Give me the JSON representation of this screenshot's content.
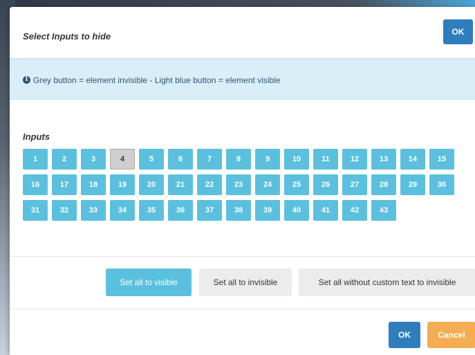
{
  "dialog": {
    "title": "Select Inputs to hide",
    "ok_top_label": "OK"
  },
  "alert": {
    "icon": "info-circle-icon",
    "icon_glyph": "i",
    "text": "Grey button = element invisible - Light blue button = element visible"
  },
  "inputs": {
    "label": "Inputs",
    "items": [
      {
        "label": "1",
        "visible": true
      },
      {
        "label": "2",
        "visible": true
      },
      {
        "label": "3",
        "visible": true
      },
      {
        "label": "4",
        "visible": false
      },
      {
        "label": "5",
        "visible": true
      },
      {
        "label": "6",
        "visible": true
      },
      {
        "label": "7",
        "visible": true
      },
      {
        "label": "8",
        "visible": true
      },
      {
        "label": "9",
        "visible": true
      },
      {
        "label": "10",
        "visible": true
      },
      {
        "label": "11",
        "visible": true
      },
      {
        "label": "12",
        "visible": true
      },
      {
        "label": "13",
        "visible": true
      },
      {
        "label": "14",
        "visible": true
      },
      {
        "label": "15",
        "visible": true
      },
      {
        "label": "16",
        "visible": true
      },
      {
        "label": "17",
        "visible": true
      },
      {
        "label": "18",
        "visible": true
      },
      {
        "label": "19",
        "visible": true
      },
      {
        "label": "20",
        "visible": true
      },
      {
        "label": "21",
        "visible": true
      },
      {
        "label": "22",
        "visible": true
      },
      {
        "label": "23",
        "visible": true
      },
      {
        "label": "24",
        "visible": true
      },
      {
        "label": "25",
        "visible": true
      },
      {
        "label": "26",
        "visible": true
      },
      {
        "label": "27",
        "visible": true
      },
      {
        "label": "28",
        "visible": true
      },
      {
        "label": "29",
        "visible": true
      },
      {
        "label": "30",
        "visible": true
      },
      {
        "label": "31",
        "visible": true
      },
      {
        "label": "32",
        "visible": true
      },
      {
        "label": "33",
        "visible": true
      },
      {
        "label": "34",
        "visible": true
      },
      {
        "label": "35",
        "visible": true
      },
      {
        "label": "36",
        "visible": true
      },
      {
        "label": "37",
        "visible": true
      },
      {
        "label": "38",
        "visible": true
      },
      {
        "label": "39",
        "visible": true
      },
      {
        "label": "40",
        "visible": true
      },
      {
        "label": "41",
        "visible": true
      },
      {
        "label": "42",
        "visible": true
      },
      {
        "label": "43",
        "visible": true
      }
    ]
  },
  "actions": {
    "set_all_visible": "Set all to visible",
    "set_all_invisible": "Set all to invisible",
    "set_custom_invisible": "Set all without custom text to invisible"
  },
  "footer": {
    "ok_label": "OK",
    "cancel_label": "Cancel"
  },
  "colors": {
    "visible_button": "#5bc0de",
    "invisible_button": "#cfcfcf",
    "primary": "#2f7dbd",
    "warning": "#f4ad52",
    "alert_bg": "#d9eef7"
  }
}
